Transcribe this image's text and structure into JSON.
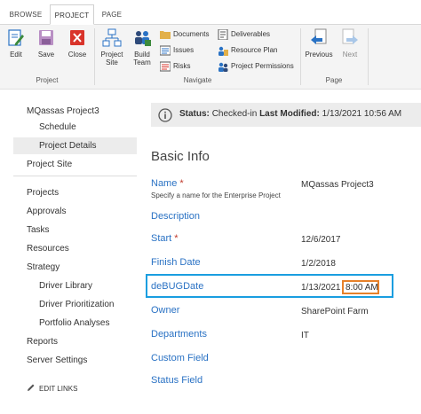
{
  "tabs": [
    {
      "label": "BROWSE",
      "active": false
    },
    {
      "label": "PROJECT",
      "active": true
    },
    {
      "label": "PAGE",
      "active": false
    }
  ],
  "ribbon": {
    "project_group": {
      "label": "Project",
      "buttons": [
        {
          "label": "Edit",
          "icon": "edit-icon"
        },
        {
          "label": "Save",
          "icon": "save-icon"
        },
        {
          "label": "Close",
          "icon": "close-icon"
        }
      ]
    },
    "navigate_group": {
      "label": "Navigate",
      "big_buttons": [
        {
          "label": "Project Site",
          "line1": "Project",
          "line2": "Site",
          "icon": "project-site-icon"
        },
        {
          "label": "Build Team",
          "line1": "Build",
          "line2": "Team",
          "icon": "build-team-icon"
        }
      ],
      "small_buttons": [
        {
          "label": "Documents",
          "icon": "documents-icon"
        },
        {
          "label": "Issues",
          "icon": "issues-icon"
        },
        {
          "label": "Risks",
          "icon": "risks-icon"
        },
        {
          "label": "Deliverables",
          "icon": "deliverables-icon"
        },
        {
          "label": "Resource Plan",
          "icon": "resource-plan-icon"
        },
        {
          "label": "Project Permissions",
          "icon": "project-permissions-icon"
        }
      ]
    },
    "page_group": {
      "label": "Page",
      "buttons": [
        {
          "label": "Previous",
          "icon": "previous-arrow-icon"
        },
        {
          "label": "Next",
          "icon": "next-arrow-icon"
        }
      ]
    }
  },
  "left_nav": {
    "project_name": "MQassas Project3",
    "project_sub": [
      "Schedule",
      "Project Details"
    ],
    "selected": "Project Details",
    "project_site": "Project Site",
    "main_items": [
      "Projects",
      "Approvals",
      "Tasks",
      "Resources",
      "Strategy"
    ],
    "strategy_sub": [
      "Driver Library",
      "Driver Prioritization",
      "Portfolio Analyses"
    ],
    "bottom_items": [
      "Reports",
      "Server Settings"
    ],
    "edit_links": "EDIT LINKS"
  },
  "status_bar": {
    "status_label": "Status:",
    "status_value": "Checked-in",
    "modified_label": "Last Modified:",
    "modified_value": "1/13/2021 10:56 AM"
  },
  "form": {
    "heading": "Basic Info",
    "fields": [
      {
        "label": "Name",
        "required": true,
        "value": "MQassas Project3",
        "description": "Specify a name for the Enterprise Project"
      },
      {
        "label": "Description",
        "required": false,
        "value": ""
      },
      {
        "label": "Start",
        "required": true,
        "value": "12/6/2017"
      },
      {
        "label": "Finish Date",
        "required": false,
        "value": "1/2/2018"
      },
      {
        "label": "deBUGDate",
        "required": false,
        "value_date": "1/13/2021",
        "value_time": "8:00 AM"
      },
      {
        "label": "Owner",
        "required": false,
        "value": "SharePoint Farm"
      },
      {
        "label": "Departments",
        "required": false,
        "value": "IT"
      },
      {
        "label": "Custom Field",
        "required": false,
        "value": ""
      },
      {
        "label": "Status Field",
        "required": false,
        "value": ""
      }
    ]
  },
  "colors": {
    "link_blue": "#2a72c4",
    "highlight_blue": "#1a9ee0",
    "highlight_orange": "#e7812a",
    "required_red": "#c0392b"
  }
}
